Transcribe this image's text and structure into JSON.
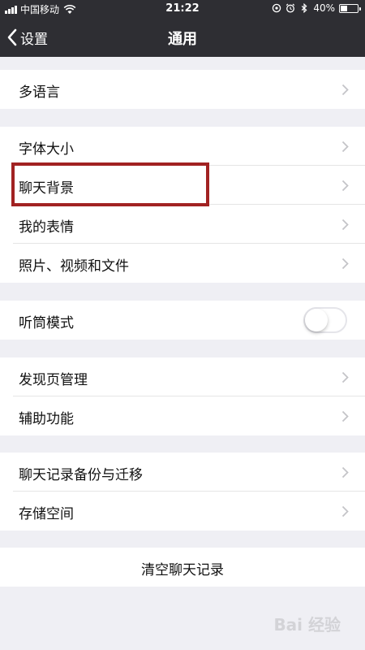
{
  "status_bar": {
    "carrier": "中国移动",
    "time": "21:22",
    "battery": "40%",
    "battery_level": 0.4
  },
  "nav": {
    "back_label": "设置",
    "title": "通用"
  },
  "groups": {
    "language": {
      "items": [
        {
          "label": "多语言"
        }
      ]
    },
    "display": {
      "items": [
        {
          "label": "字体大小"
        },
        {
          "label": "聊天背景"
        },
        {
          "label": "我的表情"
        },
        {
          "label": "照片、视频和文件"
        }
      ]
    },
    "receiver": {
      "label": "听筒模式",
      "toggle_on": false
    },
    "discover": {
      "items": [
        {
          "label": "发现页管理"
        },
        {
          "label": "辅助功能"
        }
      ]
    },
    "storage": {
      "items": [
        {
          "label": "聊天记录备份与迁移"
        },
        {
          "label": "存储空间"
        }
      ]
    },
    "clear": {
      "label": "清空聊天记录"
    }
  },
  "highlight": {
    "target": "聊天背景",
    "color": "#a12222"
  },
  "watermark": {
    "text": "Bai 经验"
  },
  "icons": [
    "signal-icon",
    "wifi-icon",
    "at-icon",
    "alarm-icon",
    "bluetooth-icon",
    "battery-icon",
    "back-chevron-icon",
    "chevron-right-icon"
  ]
}
